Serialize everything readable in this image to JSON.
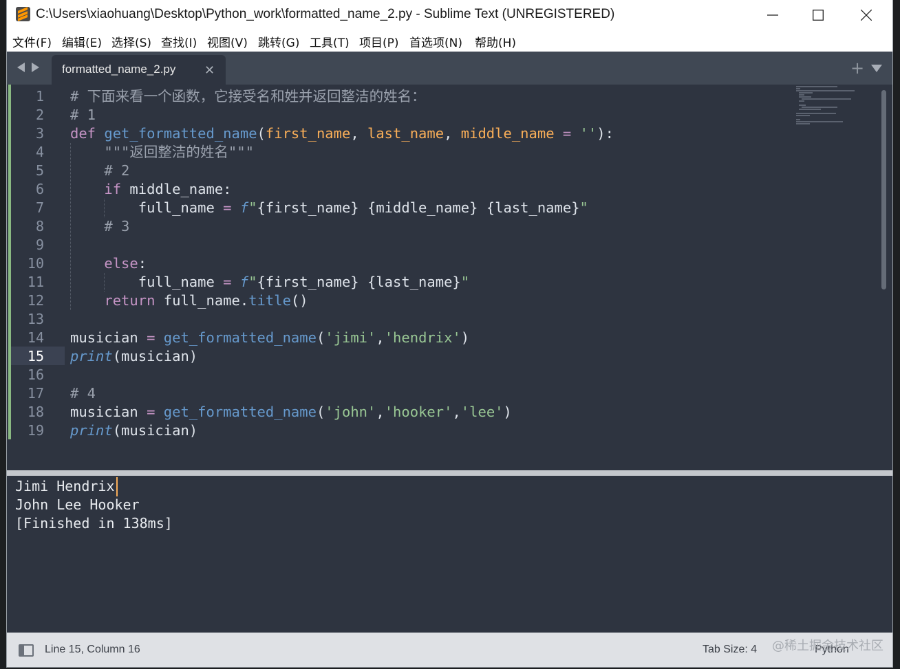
{
  "window": {
    "title": "C:\\Users\\xiaohuang\\Desktop\\Python_work\\formatted_name_2.py - Sublime Text (UNREGISTERED)",
    "icon": "sublime-text-logo-icon",
    "controls": [
      "minimize-icon",
      "maximize-icon",
      "close-icon"
    ]
  },
  "menu": [
    "文件(F)",
    "编辑(E)",
    "选择(S)",
    "查找(I)",
    "视图(V)",
    "跳转(G)",
    "工具(T)",
    "项目(P)",
    "首选项(N)",
    "帮助(H)"
  ],
  "tabs": [
    {
      "label": "formatted_name_2.py",
      "active": true
    }
  ],
  "tabbar_icons": {
    "back": "triangle-left-icon",
    "forward": "triangle-right-icon",
    "new_tab": "plus-icon",
    "tab_menu": "triangle-down-icon",
    "close": "x-icon"
  },
  "editor": {
    "current_line": 15,
    "line_numbers": [
      "1",
      "2",
      "3",
      "4",
      "5",
      "6",
      "7",
      "8",
      "9",
      "10",
      "11",
      "12",
      "13",
      "14",
      "15",
      "16",
      "17",
      "18",
      "19"
    ],
    "lines": [
      [
        [
          "cm",
          "# 下面来看一个函数，它接受名和姓并返回整洁的姓名："
        ]
      ],
      [
        [
          "cm",
          "# 1"
        ]
      ],
      [
        [
          "kw",
          "def"
        ],
        [
          "pl",
          " "
        ],
        [
          "fn",
          "get_formatted_name"
        ],
        [
          "pl",
          "("
        ],
        [
          "pr",
          "first_name"
        ],
        [
          "pl",
          ", "
        ],
        [
          "pr",
          "last_name"
        ],
        [
          "pl",
          ", "
        ],
        [
          "pr",
          "middle_name"
        ],
        [
          "pl",
          " "
        ],
        [
          "op",
          "="
        ],
        [
          "pl",
          " "
        ],
        [
          "st",
          "''"
        ],
        [
          "pl",
          "):"
        ]
      ],
      [
        [
          "cm",
          "    \"\"\"返回整洁的姓名\"\"\""
        ]
      ],
      [
        [
          "cm",
          "    # 2"
        ]
      ],
      [
        [
          "pl",
          "    "
        ],
        [
          "kw",
          "if"
        ],
        [
          "pl",
          " middle_name:"
        ]
      ],
      [
        [
          "pl",
          "        full_name "
        ],
        [
          "op",
          "="
        ],
        [
          "pl",
          " "
        ],
        [
          "bi",
          "f"
        ],
        [
          "st",
          "\""
        ],
        [
          "pl",
          "{first_name} {middle_name} {last_name}"
        ],
        [
          "st",
          "\""
        ]
      ],
      [
        [
          "cm",
          "    # 3"
        ]
      ],
      [
        [
          "pl",
          ""
        ]
      ],
      [
        [
          "pl",
          "    "
        ],
        [
          "kw",
          "else"
        ],
        [
          "pl",
          ":"
        ]
      ],
      [
        [
          "pl",
          "        full_name "
        ],
        [
          "op",
          "="
        ],
        [
          "pl",
          " "
        ],
        [
          "bi",
          "f"
        ],
        [
          "st",
          "\""
        ],
        [
          "pl",
          "{first_name} {last_name}"
        ],
        [
          "st",
          "\""
        ]
      ],
      [
        [
          "pl",
          "    "
        ],
        [
          "kw",
          "return"
        ],
        [
          "pl",
          " full_name."
        ],
        [
          "fn",
          "title"
        ],
        [
          "pl",
          "()"
        ]
      ],
      [
        [
          "pl",
          ""
        ]
      ],
      [
        [
          "pl",
          "musician "
        ],
        [
          "op",
          "="
        ],
        [
          "pl",
          " "
        ],
        [
          "fn",
          "get_formatted_name"
        ],
        [
          "pl",
          "("
        ],
        [
          "st",
          "'jimi'"
        ],
        [
          "pl",
          ","
        ],
        [
          "st",
          "'hendrix'"
        ],
        [
          "pl",
          ")"
        ]
      ],
      [
        [
          "bi",
          "print"
        ],
        [
          "pl",
          "(musician)"
        ]
      ],
      [
        [
          "pl",
          ""
        ]
      ],
      [
        [
          "cm",
          "# 4"
        ]
      ],
      [
        [
          "pl",
          "musician "
        ],
        [
          "op",
          "="
        ],
        [
          "pl",
          " "
        ],
        [
          "fn",
          "get_formatted_name"
        ],
        [
          "pl",
          "("
        ],
        [
          "st",
          "'john'"
        ],
        [
          "pl",
          ","
        ],
        [
          "st",
          "'hooker'"
        ],
        [
          "pl",
          ","
        ],
        [
          "st",
          "'lee'"
        ],
        [
          "pl",
          ")"
        ]
      ],
      [
        [
          "bi",
          "print"
        ],
        [
          "pl",
          "(musician)"
        ]
      ]
    ]
  },
  "output": {
    "lines": [
      "Jimi Hendrix",
      "John Lee Hooker",
      "[Finished in 138ms]"
    ]
  },
  "status": {
    "position": "Line 15, Column 16",
    "tab_size": "Tab Size: 4",
    "syntax": "Python",
    "watermark": "@稀土掘金技术社区",
    "panel_icon": "panel-toggle-icon"
  },
  "colors": {
    "editor_bg": "#2e3440",
    "tabbar_bg": "#404854",
    "comment": "#9aa1ad",
    "keyword": "#c594c5",
    "function": "#6699cc",
    "param": "#f9ae58",
    "string": "#99c794"
  }
}
